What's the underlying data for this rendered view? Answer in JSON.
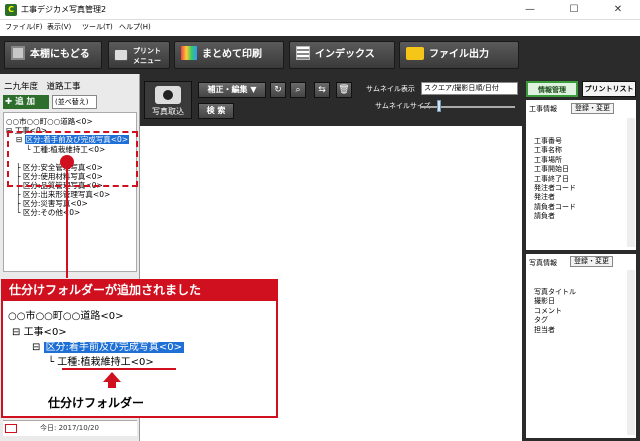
{
  "window": {
    "title": "工事デジカメ写真管理2",
    "app_icon_text": "C",
    "controls": [
      "—",
      "☐",
      "✕"
    ]
  },
  "menu": [
    "ファイル(F)",
    "表示(V)",
    "ツール(T)",
    "ヘルプ(H)"
  ],
  "toolbar": {
    "back_label": "本棚にもどる",
    "print_menu_label_1": "プリント",
    "print_menu_label_2": "メニュー",
    "bulk_print_label": "まとめて印刷",
    "index_label": "インデックス",
    "file_output_label": "ファイル出力"
  },
  "left": {
    "project_title": "二九年度　道路工事",
    "add_label": "追 加",
    "sort_value": "(並べ替え)",
    "tree": [
      "○○市○○町○○道路<0>",
      "工事<0>",
      "区分:着手前及び完成写真<0>",
      "工種:植栽維持工<0>",
      "区分:安全管理写真<0>",
      "区分:使用材料写真<0>",
      "区分:品質管理写真<0>",
      "区分:出来形管理写真<0>",
      "区分:災害写真<0>",
      "区分:その他<0>"
    ],
    "today_label": "今日: 2017/10/20"
  },
  "middle": {
    "photo_import_label": "写真取込",
    "edit_label": "補正・編集 ▼",
    "search_label": "検 索",
    "thumb_display_label": "サムネイル表示",
    "thumb_display_value": "スクエア/撮影日順/日付",
    "thumb_size_label": "サムネイルサイズ",
    "thumb_size_fraction": 0.2
  },
  "right": {
    "tab_info": "情報管理",
    "tab_print": "プリントリスト",
    "work_info_label": "工事情報",
    "register_label": "登録・変更",
    "work_fields": [
      "工事番号",
      "工事名称",
      "工事場所",
      "工事開始日",
      "工事終了日",
      "発注者コード",
      "発注者",
      "請負者コード",
      "請負者"
    ],
    "photo_info_label": "写真情報",
    "photo_fields": [
      "写真タイトル",
      "撮影日",
      "コメント",
      "タグ",
      "担当者"
    ]
  },
  "callout": {
    "banner": "仕分けフォルダーが追加されました",
    "tree": [
      "○○市○○町○○道路<0>",
      "工事<0>",
      "区分:着手前及び完成写真<0>",
      "工種:植栽維持工<0>"
    ],
    "caption": "仕分けフォルダー"
  },
  "colors": {
    "accent_red": "#d0101e",
    "selection_blue": "#1e6fd6",
    "toolbar_dark": "#2b2b2b",
    "add_green": "#2d6e2d"
  }
}
